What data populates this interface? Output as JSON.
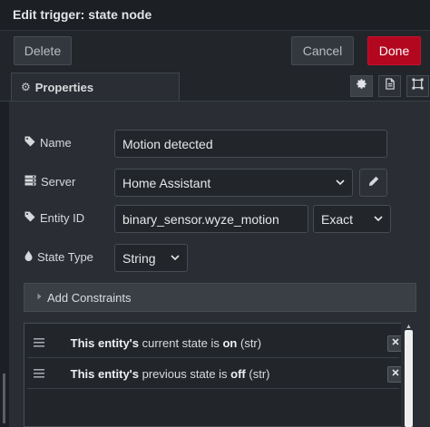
{
  "dialog": {
    "title": "Edit trigger: state node"
  },
  "actions": {
    "delete_label": "Delete",
    "cancel_label": "Cancel",
    "done_label": "Done"
  },
  "tabs": {
    "active_label": "Properties",
    "icons": [
      "gear-icon",
      "description-icon",
      "appearance-icon"
    ]
  },
  "form": {
    "name": {
      "label": "Name",
      "value": "Motion detected"
    },
    "server": {
      "label": "Server",
      "value": "Home Assistant"
    },
    "entity_id": {
      "label": "Entity ID",
      "value": "binary_sensor.wyze_motion",
      "match_mode": "Exact"
    },
    "state_type": {
      "label": "State Type",
      "value": "String"
    }
  },
  "constraints": {
    "header_label": "Add Constraints",
    "items": [
      {
        "subject": "This entity's",
        "property": " current state is ",
        "value": "on",
        "type": " (str)"
      },
      {
        "subject": "This entity's",
        "property": " previous state is ",
        "value": "off",
        "type": " (str)"
      }
    ]
  },
  "colors": {
    "accent_done": "#b3071f",
    "background": "#22262b",
    "panel": "#2a2e34"
  }
}
